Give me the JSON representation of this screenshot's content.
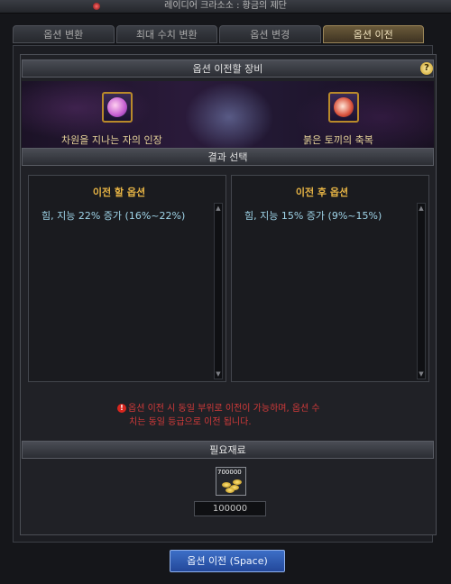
{
  "window": {
    "title": "레이디어 크라소소 : 황금의 제단"
  },
  "tabs": [
    {
      "label": "옵션 변환",
      "active": false
    },
    {
      "label": "최대 수치 변환",
      "active": false
    },
    {
      "label": "옵션 변경",
      "active": false
    },
    {
      "label": "옵션 이전",
      "active": true
    }
  ],
  "equipment_section": {
    "title": "옵션 이전할 장비",
    "help": "?",
    "source_item": {
      "name": "차원을 지나는 자의 인장",
      "icon": "seal-icon"
    },
    "target_item": {
      "name": "붉은 토끼의 축복",
      "icon": "rabbit-blessing-icon"
    }
  },
  "result_section": {
    "title": "결과 선택",
    "before": {
      "title": "이전 할 옵션",
      "option": "힘, 지능 22% 증가 (16%~22%)"
    },
    "after": {
      "title": "이전 후 옵션",
      "option": "힘, 지능 15% 증가 (9%~15%)"
    }
  },
  "warning": {
    "icon": "!",
    "line1": "옵션 이전 시 동일 부위로 이전이 가능하며, 옵션 수",
    "line2": "치는 동일 등급으로 이전 됩니다."
  },
  "materials": {
    "title": "필요재료",
    "item_icon": "gold-coin-icon",
    "badge": "700000",
    "quantity": "100000"
  },
  "action": {
    "transfer_label": "옵션 이전 (Space)"
  },
  "colors": {
    "active_tab": "#6a5a3a",
    "option_title": "#e8b545",
    "option_text": "#9fd4e8",
    "warning": "#d23a3a",
    "button": "#3d6fc7"
  }
}
